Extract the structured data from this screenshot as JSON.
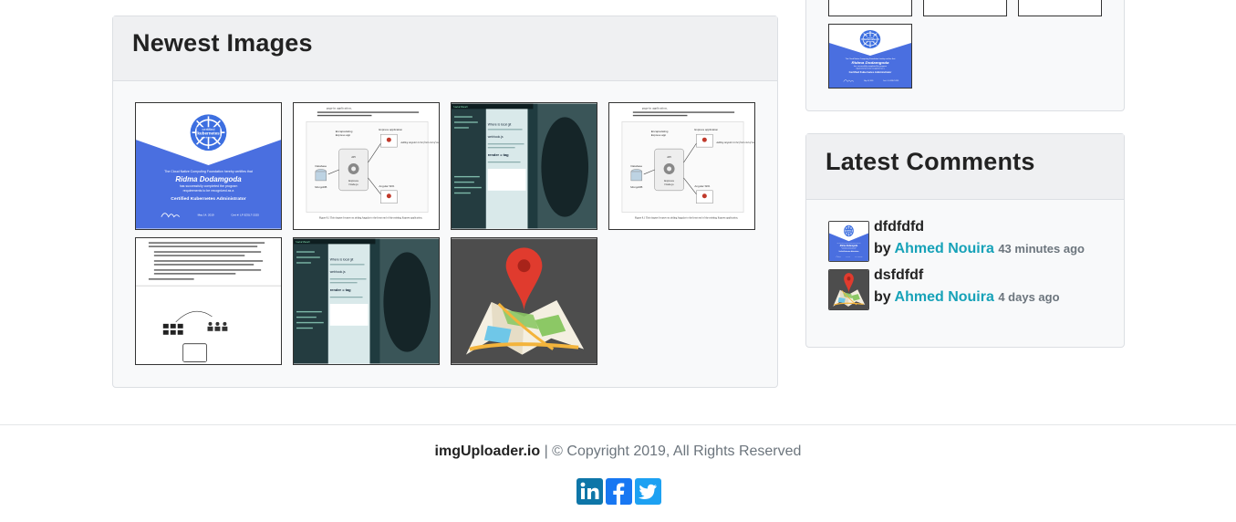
{
  "newest": {
    "title": "Newest Images",
    "images": [
      {
        "icon": "certificate-thumbnail-icon"
      },
      {
        "icon": "diagram-thumbnail-icon"
      },
      {
        "icon": "code-screen-thumbnail-icon"
      },
      {
        "icon": "diagram-thumbnail-icon"
      },
      {
        "icon": "document-thumbnail-icon"
      },
      {
        "icon": "code-screen-thumbnail-icon"
      },
      {
        "icon": "map-pin-thumbnail-icon"
      }
    ]
  },
  "cert": {
    "logo_line1": "certified",
    "logo_line2": "kubernetes",
    "logo_line3": "administrator",
    "intro": "The Cloud Native Computing Foundation hereby certifies that",
    "name": "Ridma Dodamgoda",
    "body1": "has successfully completed the program",
    "body2": "requirements to be recognized as a",
    "role": "Certified Kubernetes Administrator",
    "date": "May 14, 2019",
    "cert_id": "Cert #: LF-3ZSL7-2325"
  },
  "diagram": {
    "heading": "page in application.",
    "para": "Figure 8.1 shows where we are in the overall plan, adding Angular to the front end of the existing Express application.",
    "db1": "Database",
    "db2": "MongoDB",
    "api": "API",
    "node1": "Express",
    "node2": "Node.js",
    "encap1": "Encapsulating",
    "encap2": "Express app",
    "app1": "Express application",
    "app2": "Angular SPA",
    "adding": "Adding Angular to the front end of our Express app",
    "caption": "Figure 8.1 This chapter focuses on adding Angular to the front end of the existing Express application."
  },
  "code_screen": {
    "title": "localhost",
    "line1": "Where is local git",
    "line2": "webhook.js",
    "line3": "render = tag"
  },
  "sidebar": {
    "recent_images": [
      {
        "icon": "diagram-thumbnail-icon"
      },
      {
        "icon": "code-screen-thumbnail-icon"
      },
      {
        "icon": "diagram-thumbnail-icon"
      },
      {
        "icon": "certificate-thumbnail-icon"
      }
    ]
  },
  "comments": {
    "title": "Latest Comments",
    "by_label": "by",
    "items": [
      {
        "text": "dfdfdfd",
        "author": "Ahmed Nouira",
        "time": "43 minutes ago",
        "avatar_icon": "certificate-thumbnail-icon"
      },
      {
        "text": "dsfdfdf",
        "author": "Ahmed Nouira",
        "time": "4 days ago",
        "avatar_icon": "map-pin-thumbnail-icon"
      }
    ]
  },
  "footer": {
    "brand": "imgUploader.io",
    "copyright": " | © Copyright 2019, All Rights Reserved",
    "social": [
      {
        "name": "linkedin",
        "icon": "linkedin-icon",
        "color": "#0e76a8"
      },
      {
        "name": "facebook",
        "icon": "facebook-icon",
        "color": "#1877f2"
      },
      {
        "name": "twitter",
        "icon": "twitter-icon",
        "color": "#1da1f2"
      }
    ]
  },
  "colors": {
    "accent_link": "#17a2b8",
    "cert_blue": "#4a6fe0",
    "map_bg": "#4d4d4d",
    "code_bg": "#1f3b3f"
  }
}
